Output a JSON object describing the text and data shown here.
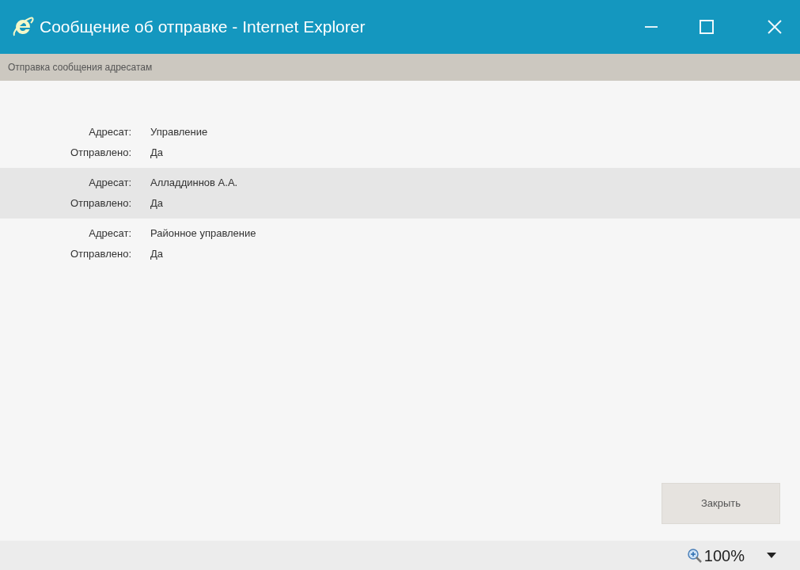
{
  "window": {
    "title": "Сообщение об отправке - Internet Explorer"
  },
  "header": {
    "text": "Отправка сообщения адресатам"
  },
  "rows": [
    {
      "recipient_label": "Адресат:",
      "recipient": "Управление",
      "sent_label": "Отправлено:",
      "sent": "Да",
      "selected": false
    },
    {
      "recipient_label": "Адресат:",
      "recipient": "Алладдиннов А.А.",
      "sent_label": "Отправлено:",
      "sent": "Да",
      "selected": true
    },
    {
      "recipient_label": "Адресат:",
      "recipient": "Районное управление",
      "sent_label": "Отправлено:",
      "sent": "Да",
      "selected": false
    }
  ],
  "buttons": [
    {
      "label": "Закрыть"
    }
  ],
  "status_bar": {
    "zoom": "100%"
  }
}
